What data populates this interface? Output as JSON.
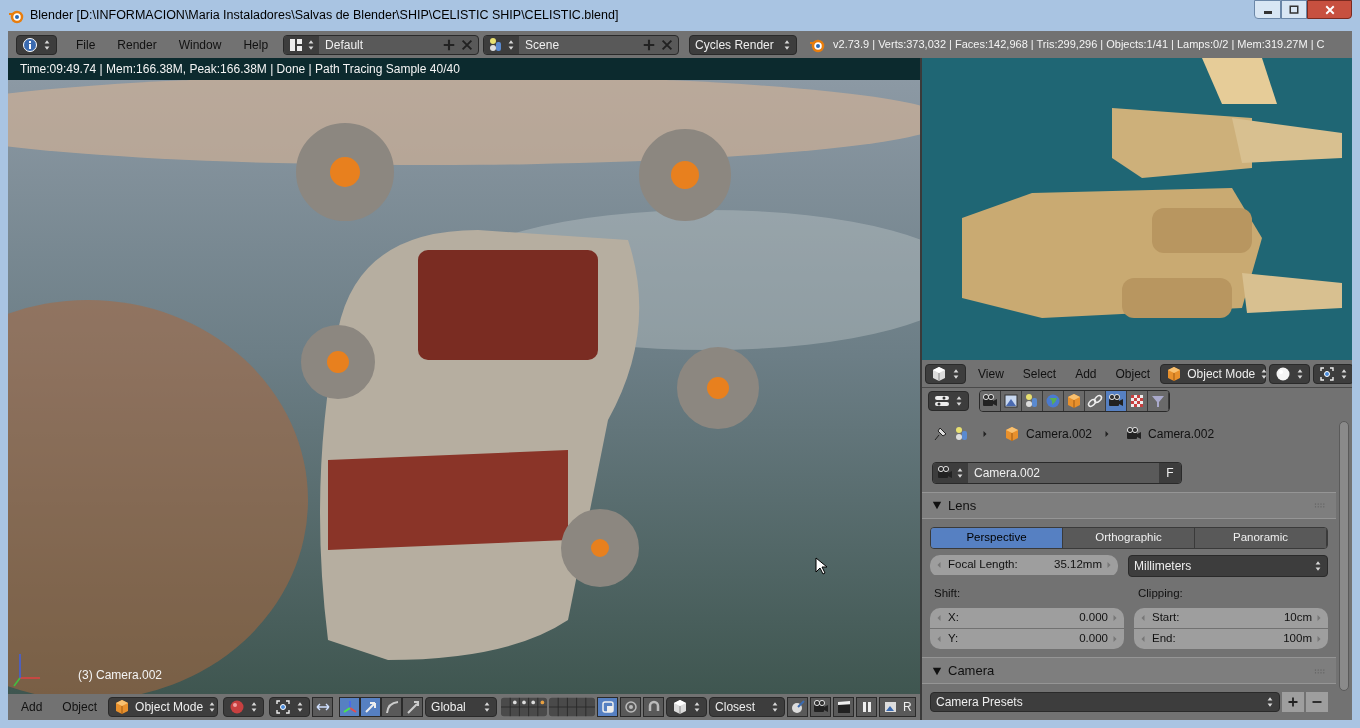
{
  "window": {
    "title": "Blender [D:\\INFORMACION\\Maria Instaladores\\Salvas de Blender\\SHIP\\CELISTIC SHIP\\CELISTIC.blend]"
  },
  "header": {
    "menus": [
      "File",
      "Render",
      "Window",
      "Help"
    ],
    "screen_layout": "Default",
    "scene": "Scene",
    "render_engine": "Cycles Render",
    "stats": "v2.73.9 | Verts:373,032 | Faces:142,968 | Tris:299,296 | Objects:1/41 | Lamps:0/2 | Mem:319.27M | C"
  },
  "viewport": {
    "render_info": "Time:09:49.74 | Mem:166.38M, Peak:166.38M | Done | Path Tracing Sample 40/40",
    "object_label": "(3) Camera.002"
  },
  "toolbar": {
    "menus": [
      "Add",
      "Object"
    ],
    "mode": "Object Mode",
    "manipulators": [
      {
        "selected": true
      },
      {
        "selected": true
      },
      {
        "selected": false
      },
      {
        "selected": false
      }
    ],
    "orientation": "Global",
    "lock_layers_on": true,
    "snap_target": "Closest",
    "render_label": "R"
  },
  "side_view_header": {
    "menus": [
      "View",
      "Select",
      "Add",
      "Object"
    ],
    "mode": "Object Mode"
  },
  "properties": {
    "tabs": [
      {
        "selected": false
      },
      {
        "selected": false
      },
      {
        "selected": false
      },
      {
        "selected": false
      },
      {
        "selected": false
      },
      {
        "selected": false
      },
      {
        "selected": true
      },
      {
        "selected": false
      },
      {
        "selected": false
      }
    ],
    "breadcrumbs": [
      "Camera.002",
      "Camera.002"
    ],
    "datablock": "Camera.002",
    "fake_user": "F",
    "panels": [
      {
        "kind": "lens",
        "title": "Lens",
        "expanded": true,
        "types": [
          {
            "label": "Perspective",
            "selected": true
          },
          {
            "label": "Orthographic",
            "selected": false
          },
          {
            "label": "Panoramic",
            "selected": false
          }
        ],
        "focal_label": "Focal Length:",
        "focal_value": "35.12mm",
        "unit": "Millimeters",
        "shift_label": "Shift:",
        "shift": [
          {
            "label": "X:",
            "value": "0.000"
          },
          {
            "label": "Y:",
            "value": "0.000"
          }
        ],
        "clipping_label": "Clipping:",
        "clipping": [
          {
            "label": "Start:",
            "value": "10cm"
          },
          {
            "label": "End:",
            "value": "100m"
          }
        ]
      },
      {
        "kind": "camera",
        "title": "Camera",
        "expanded": true,
        "presets": "Camera Presets"
      }
    ]
  }
}
